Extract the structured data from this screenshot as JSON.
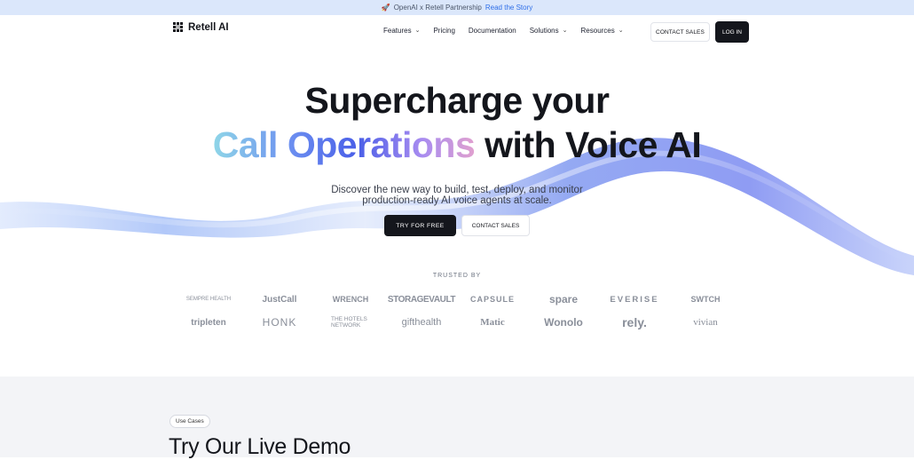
{
  "banner": {
    "text": "OpenAI x Retell Partnership",
    "link": "Read the Story"
  },
  "nav": {
    "brand": "Retell AI",
    "items": [
      {
        "label": "Features",
        "dropdown": true
      },
      {
        "label": "Pricing",
        "dropdown": false
      },
      {
        "label": "Documentation",
        "dropdown": false
      },
      {
        "label": "Solutions",
        "dropdown": true
      },
      {
        "label": "Resources",
        "dropdown": true
      }
    ],
    "contact_label": "CONTACT SALES",
    "login_label": "LOG IN"
  },
  "hero": {
    "line1": "Supercharge your",
    "line2_gradient": "Call Operations",
    "line2_rest": " with Voice AI",
    "sub1": "Discover the new way to build, test, deploy, and monitor",
    "sub2": "production-ready AI voice agents at scale.",
    "try_label": "TRY FOR FREE",
    "contact_label": "CONTACT SALES"
  },
  "trusted": {
    "label": "TRUSTED BY",
    "row1": [
      "SEMPRE HEALTH",
      "JustCall",
      "WRENCH",
      "STORAGEVAULT",
      "CAPSULE",
      "spare",
      "EVERISE",
      "SWTCH"
    ],
    "row2": [
      "tripleten",
      "HONK",
      "THE HOTELS NETWORK",
      "gifthealth",
      "Matic",
      "Wonolo",
      "rely.",
      "vivian"
    ]
  },
  "demo": {
    "tag": "Use Cases",
    "title": "Try Our Live Demo"
  },
  "colors": {
    "accent": "#2f6fe8",
    "dark": "#14161c",
    "banner_bg": "#dbe7fb"
  }
}
